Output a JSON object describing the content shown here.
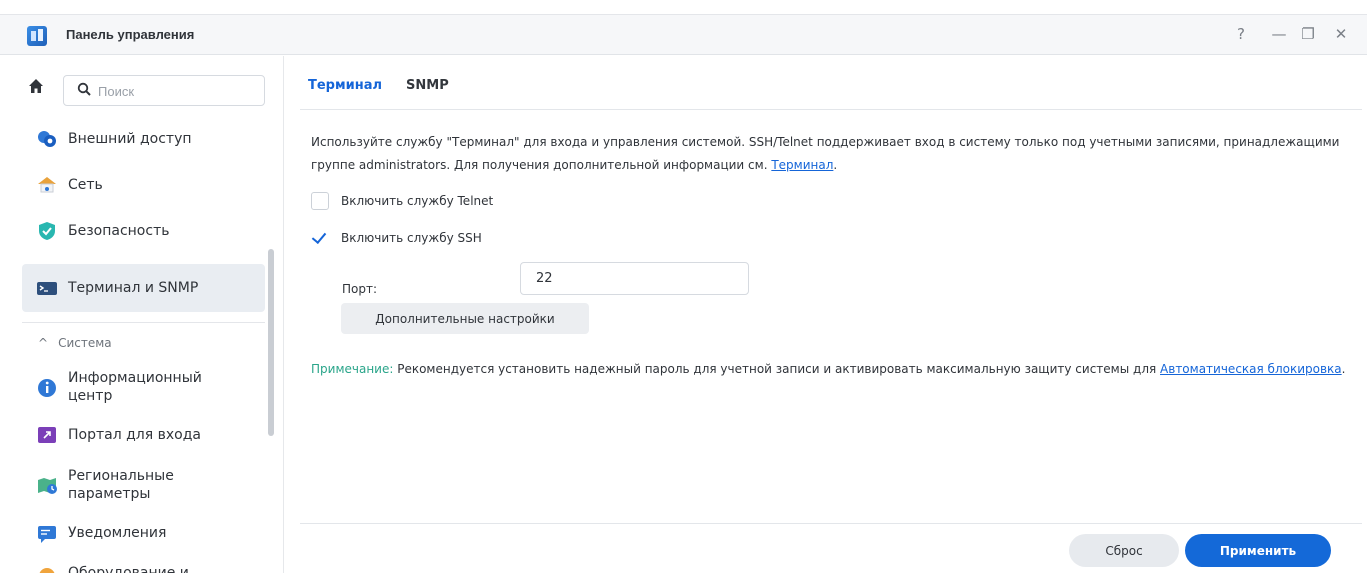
{
  "window": {
    "title": "Панель управления",
    "controls": {
      "help": "?",
      "minimize": "—",
      "restore": "❐",
      "close": "✕"
    }
  },
  "sidebar": {
    "search_placeholder": "Поиск",
    "items": [
      {
        "label": "Внешний доступ",
        "icon": "external-access-icon"
      },
      {
        "label": "Сеть",
        "icon": "network-icon"
      },
      {
        "label": "Безопасность",
        "icon": "shield-icon"
      },
      {
        "label": "Терминал и SNMP",
        "icon": "terminal-icon",
        "active": true
      }
    ],
    "section": {
      "label": "Система",
      "toggle": "^"
    },
    "system_items": [
      {
        "label": "Информационный центр",
        "icon": "info-icon"
      },
      {
        "label": "Портал для входа",
        "icon": "login-portal-icon"
      },
      {
        "label": "Региональные параметры",
        "icon": "regional-icon"
      },
      {
        "label": "Уведомления",
        "icon": "notifications-icon"
      },
      {
        "label": "Оборудование и",
        "icon": "hardware-icon"
      }
    ]
  },
  "tabs": [
    {
      "label": "Терминал",
      "active": true
    },
    {
      "label": "SNMP",
      "active": false
    }
  ],
  "description": {
    "text": "Используйте службу \"Терминал\" для входа и управления системой. SSH/Telnet поддерживает вход в систему только под учетными записями, принадлежащими группе administrators. Для получения дополнительной информации см. ",
    "link": "Терминал",
    "end": "."
  },
  "options": {
    "telnet": {
      "label": "Включить службу Telnet",
      "checked": false
    },
    "ssh": {
      "label": "Включить службу SSH",
      "checked": true
    }
  },
  "port": {
    "label": "Порт:",
    "value": "22"
  },
  "advanced_button": "Дополнительные настройки",
  "note": {
    "prefix": "Примечание:",
    "text": " Рекомендуется установить надежный пароль для учетной записи и активировать максимальную защиту системы для ",
    "link": "Автоматическая блокировка",
    "end": "."
  },
  "footer": {
    "reset": "Сброс",
    "apply": "Применить"
  },
  "colors": {
    "accent": "#1469d8",
    "note": "#2aa58a",
    "active_bg": "#e9edf2"
  }
}
